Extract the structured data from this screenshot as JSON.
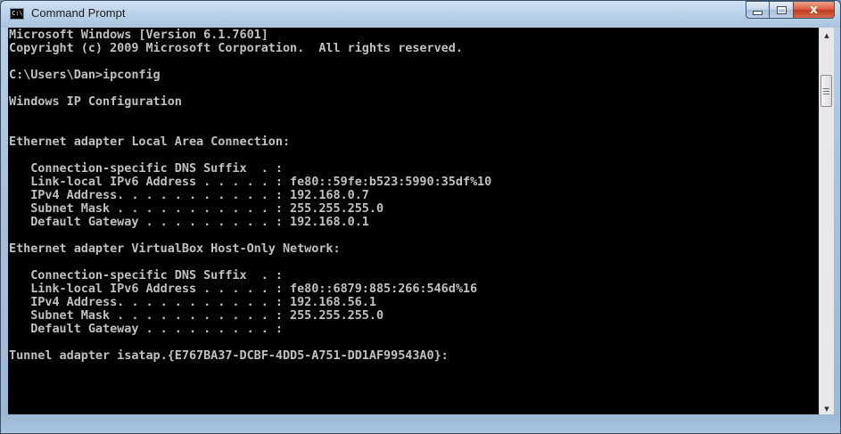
{
  "window": {
    "title": "Command Prompt",
    "icon_label": "C:\\.",
    "controls": {
      "minimize": "minimize",
      "maximize": "maximize",
      "close": "x"
    }
  },
  "console": {
    "lines": [
      "Microsoft Windows [Version 6.1.7601]",
      "Copyright (c) 2009 Microsoft Corporation.  All rights reserved.",
      "",
      "C:\\Users\\Dan>ipconfig",
      "",
      "Windows IP Configuration",
      "",
      "",
      "Ethernet adapter Local Area Connection:",
      "",
      "   Connection-specific DNS Suffix  . :",
      "   Link-local IPv6 Address . . . . . : fe80::59fe:b523:5990:35df%10",
      "   IPv4 Address. . . . . . . . . . . : 192.168.0.7",
      "   Subnet Mask . . . . . . . . . . . : 255.255.255.0",
      "   Default Gateway . . . . . . . . . : 192.168.0.1",
      "",
      "Ethernet adapter VirtualBox Host-Only Network:",
      "",
      "   Connection-specific DNS Suffix  . :",
      "   Link-local IPv6 Address . . . . . : fe80::6879:885:266:546d%16",
      "   IPv4 Address. . . . . . . . . . . : 192.168.56.1",
      "   Subnet Mask . . . . . . . . . . . : 255.255.255.0",
      "   Default Gateway . . . . . . . . . :",
      "",
      "Tunnel adapter isatap.{E767BA37-DCBF-4DD5-A751-DD1AF99543A0}:"
    ]
  },
  "scrollbar": {
    "up_icon": "triangle-up",
    "down_icon": "triangle-down"
  },
  "colors": {
    "console_bg": "#000000",
    "console_fg": "#c0c0c0",
    "close_button": "#c43b1f"
  }
}
